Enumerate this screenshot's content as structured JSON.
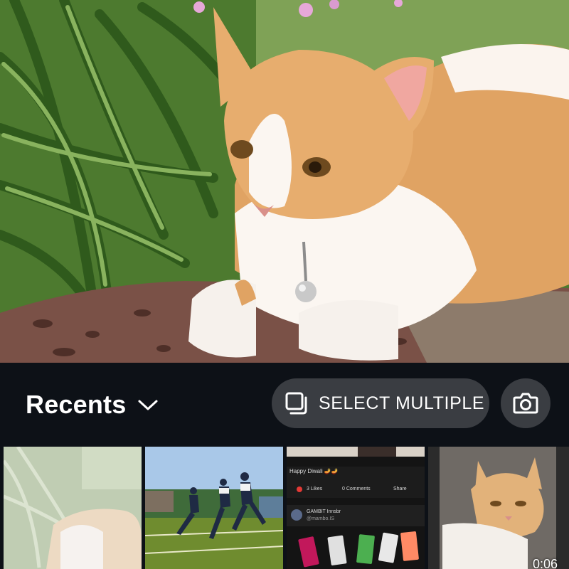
{
  "toolbar": {
    "album_label": "Recents",
    "select_multiple_label": "SELECT MULTIPLE"
  },
  "thumbnails": [
    {
      "kind": "photo"
    },
    {
      "kind": "photo"
    },
    {
      "kind": "screenshot",
      "caption": "Happy Diwali 🪔🪔",
      "likes": "3 Likes",
      "comments": "0 Comments",
      "share": "Share",
      "name": "GAMBIT Innsbr",
      "handle": "@mambo.IS"
    },
    {
      "kind": "video",
      "duration": "0:06"
    }
  ],
  "colors": {
    "background": "#0d1117",
    "pill": "#3a3d42",
    "text": "#ffffff"
  },
  "icons": {
    "album_dropdown": "chevron-down-icon",
    "select_multiple": "multi-select-icon",
    "camera": "camera-icon"
  }
}
